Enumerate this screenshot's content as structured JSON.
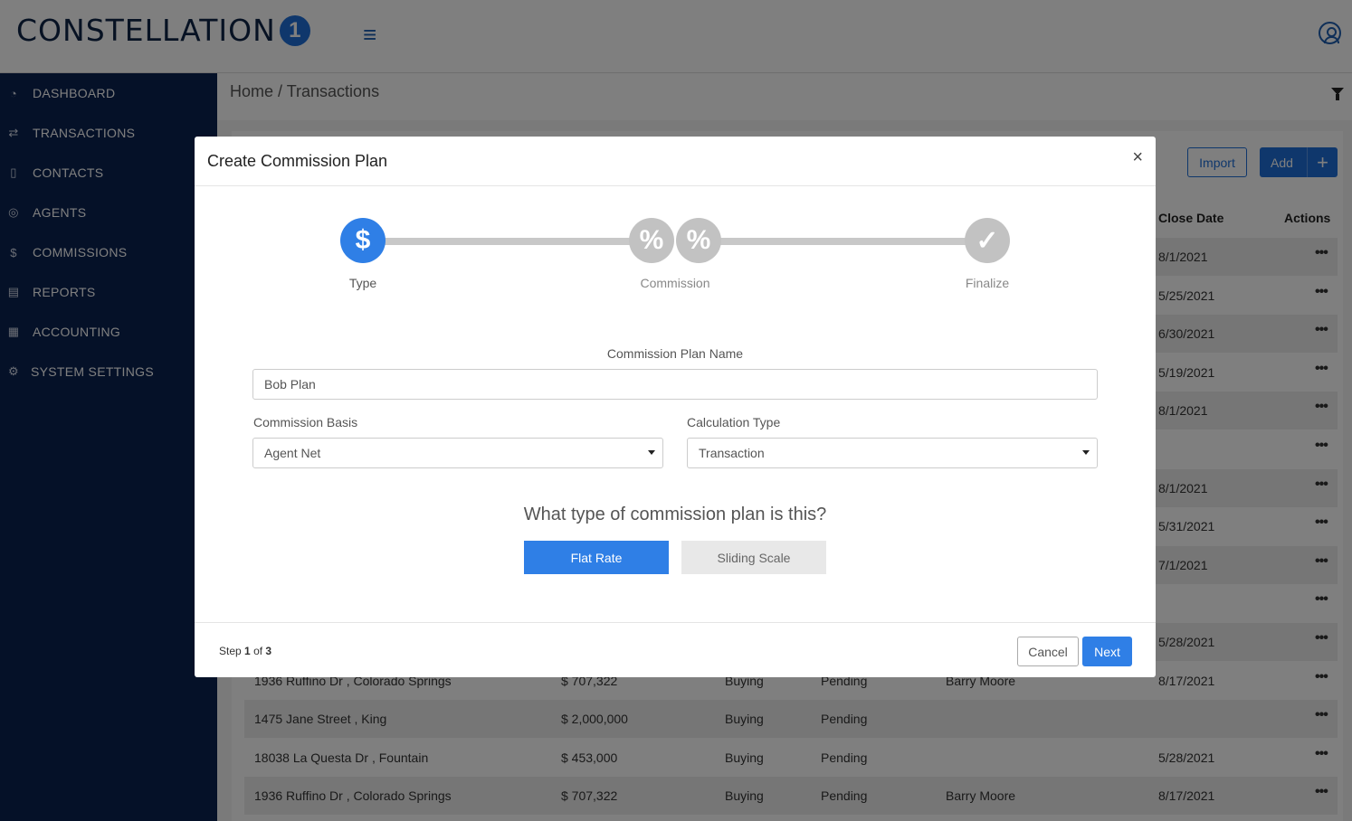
{
  "header": {
    "logo_text": "CONSTELLATION",
    "logo_badge": "1",
    "menu_icon": "≡"
  },
  "sidebar": {
    "items": [
      {
        "label": "DASHBOARD",
        "icon": "◔"
      },
      {
        "label": "TRANSACTIONS",
        "icon": "⇄"
      },
      {
        "label": "CONTACTS",
        "icon": "▯"
      },
      {
        "label": "AGENTS",
        "icon": "◎"
      },
      {
        "label": "COMMISSIONS",
        "icon": "$"
      },
      {
        "label": "REPORTS",
        "icon": "▤"
      },
      {
        "label": "ACCOUNTING",
        "icon": "▦"
      },
      {
        "label": "SYSTEM SETTINGS",
        "icon": "⚙"
      }
    ]
  },
  "breadcrumb": "Home / Transactions",
  "toolbar": {
    "import_label": "Import",
    "add_label": "Add",
    "add_plus": "+"
  },
  "table": {
    "headers": {
      "close_date": "Close Date",
      "actions": "Actions"
    },
    "actions_glyph": "•••",
    "rows": [
      {
        "address": "",
        "price": "",
        "side": "",
        "status": "",
        "agent": "",
        "close_date": "8/1/2021"
      },
      {
        "address": "",
        "price": "",
        "side": "",
        "status": "",
        "agent": "",
        "close_date": "5/25/2021"
      },
      {
        "address": "",
        "price": "",
        "side": "",
        "status": "",
        "agent": "",
        "close_date": "6/30/2021"
      },
      {
        "address": "",
        "price": "",
        "side": "",
        "status": "",
        "agent": "",
        "close_date": "5/19/2021"
      },
      {
        "address": "",
        "price": "",
        "side": "",
        "status": "",
        "agent": "",
        "close_date": "8/1/2021"
      },
      {
        "address": "",
        "price": "",
        "side": "",
        "status": "",
        "agent": "",
        "close_date": ""
      },
      {
        "address": "",
        "price": "",
        "side": "",
        "status": "",
        "agent": "",
        "close_date": "8/1/2021"
      },
      {
        "address": "",
        "price": "",
        "side": "",
        "status": "",
        "agent": "",
        "close_date": "5/31/2021"
      },
      {
        "address": "",
        "price": "",
        "side": "",
        "status": "",
        "agent": "",
        "close_date": "7/1/2021"
      },
      {
        "address": "",
        "price": "",
        "side": "",
        "status": "",
        "agent": "",
        "close_date": ""
      },
      {
        "address": "",
        "price": "",
        "side": "",
        "status": "",
        "agent": "",
        "close_date": "5/28/2021"
      },
      {
        "address": "1936 Ruffino Dr , Colorado Springs",
        "price": "$ 707,322",
        "side": "Buying",
        "status": "Pending",
        "agent": "Barry Moore",
        "close_date": "8/17/2021"
      },
      {
        "address": "1475 Jane Street , King",
        "price": "$ 2,000,000",
        "side": "Buying",
        "status": "Pending",
        "agent": "",
        "close_date": ""
      },
      {
        "address": "18038 La Questa Dr , Fountain",
        "price": "$ 453,000",
        "side": "Buying",
        "status": "Pending",
        "agent": "",
        "close_date": "5/28/2021"
      },
      {
        "address": "1936 Ruffino Dr , Colorado Springs",
        "price": "$ 707,322",
        "side": "Buying",
        "status": "Pending",
        "agent": "Barry Moore",
        "close_date": "8/17/2021"
      }
    ]
  },
  "modal": {
    "title": "Create Commission Plan",
    "close_glyph": "×",
    "steps": [
      {
        "label": "Type",
        "glyph": "$"
      },
      {
        "label": "Commission",
        "glyph": "%"
      },
      {
        "label": "Finalize",
        "glyph": "✓"
      }
    ],
    "plan_name_label": "Commission Plan Name",
    "plan_name_value": "Bob Plan",
    "basis_label": "Commission Basis",
    "basis_value": "Agent Net",
    "calc_label": "Calculation Type",
    "calc_value": "Transaction",
    "question": "What type of commission plan is this?",
    "flat_rate_label": "Flat Rate",
    "sliding_scale_label": "Sliding Scale",
    "step_prefix": "Step",
    "step_current": "1",
    "step_of": "of",
    "step_total": "3",
    "cancel_label": "Cancel",
    "next_label": "Next"
  },
  "colors": {
    "brand_navy": "#0b2250",
    "accent_blue": "#2f7fe6"
  }
}
